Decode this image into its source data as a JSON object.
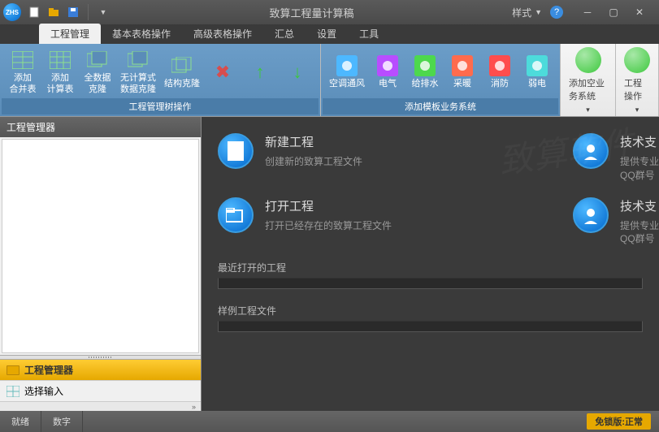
{
  "title": "致算工程量计算稿",
  "style_label": "样式",
  "tabs": [
    "工程管理",
    "基本表格操作",
    "高级表格操作",
    "汇总",
    "设置",
    "工具"
  ],
  "ribbon": {
    "group1": {
      "label": "工程管理树操作",
      "items": [
        {
          "label": "添加\n合并表"
        },
        {
          "label": "添加\n计算表"
        },
        {
          "label": "全数据\n克隆"
        },
        {
          "label": "无计算式\n数据克隆"
        },
        {
          "label": "结构克隆"
        }
      ]
    },
    "group2": {
      "label": "添加模板业务系统",
      "items": [
        {
          "label": "空调通风",
          "color": "#4db8ff"
        },
        {
          "label": "电气",
          "color": "#b84dff"
        },
        {
          "label": "给排水",
          "color": "#4dd84d"
        },
        {
          "label": "采暖",
          "color": "#ff6b4d"
        },
        {
          "label": "消防",
          "color": "#ff4d4d"
        },
        {
          "label": "弱电",
          "color": "#4ddbdb"
        }
      ]
    },
    "group3": {
      "label": "添加空业务系统"
    },
    "group4": {
      "label": "工程操作"
    }
  },
  "left": {
    "header": "工程管理器",
    "selected": "工程管理器",
    "input_label": "选择输入"
  },
  "cards": {
    "new": {
      "title": "新建工程",
      "desc": "创建新的致算工程文件"
    },
    "open": {
      "title": "打开工程",
      "desc": "打开已经存在的致算工程文件"
    },
    "support1": {
      "title": "技术支",
      "desc": "提供专业\nQQ群号"
    },
    "support2": {
      "title": "技术支",
      "desc": "提供专业\nQQ群号"
    }
  },
  "sections": {
    "recent": "最近打开的工程",
    "sample": "样例工程文件"
  },
  "status": {
    "ready": "就绪",
    "number": "数字",
    "lock": "免锁版:正常"
  }
}
